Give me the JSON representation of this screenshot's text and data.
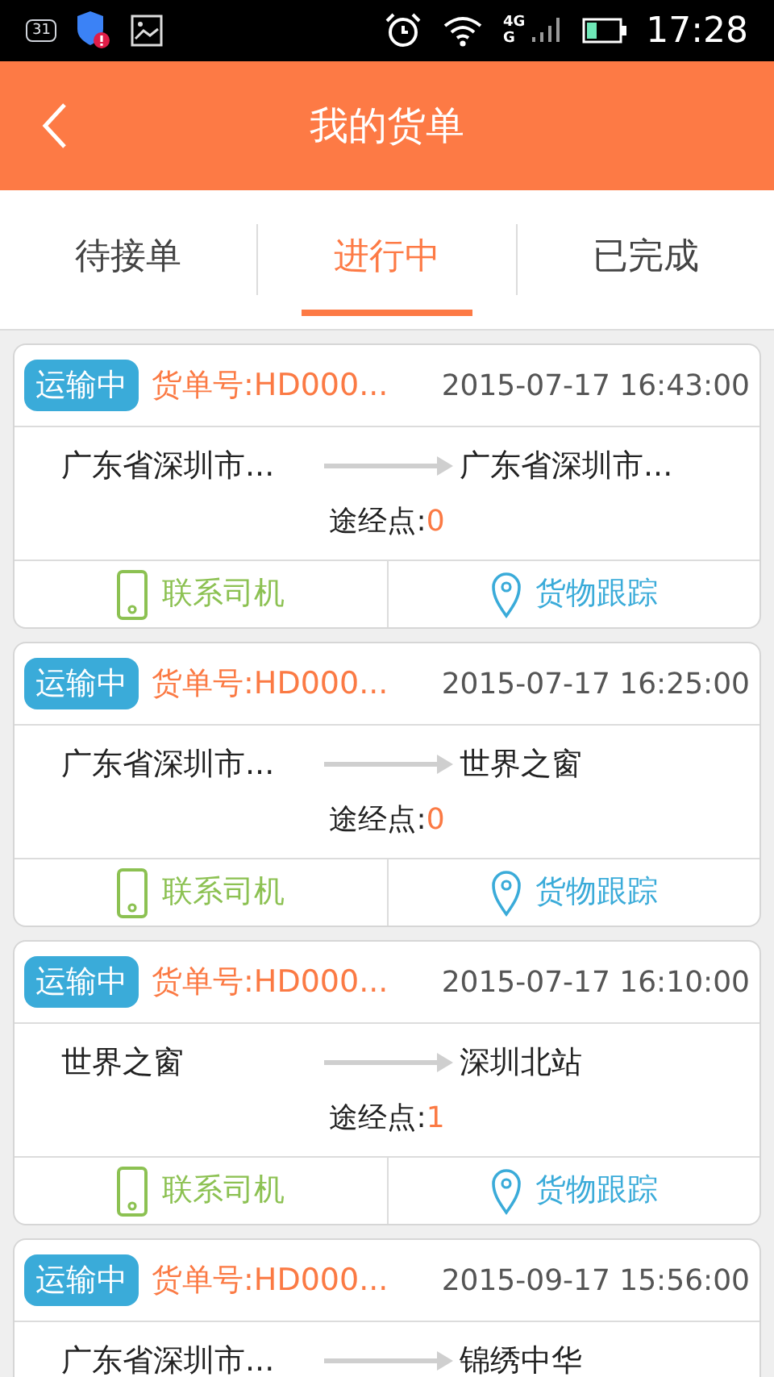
{
  "status_bar": {
    "calendar_day": "31",
    "network": "4G",
    "network_2": "G",
    "time": "17:28"
  },
  "header": {
    "title": "我的货单"
  },
  "tabs": [
    {
      "label": "待接单",
      "selected": false
    },
    {
      "label": "进行中",
      "selected": true
    },
    {
      "label": "已完成",
      "selected": false
    }
  ],
  "orders": [
    {
      "status": "运输中",
      "order_no": "货单号:HD000...",
      "time": "2015-07-17 16:43:00",
      "from": "广东省深圳市...",
      "to": "广东省深圳市...",
      "waypoint_label": "途经点:",
      "waypoint_count": "0",
      "contact": "联系司机",
      "track": "货物跟踪"
    },
    {
      "status": "运输中",
      "order_no": "货单号:HD000...",
      "time": "2015-07-17 16:25:00",
      "from": "广东省深圳市...",
      "to": "世界之窗",
      "waypoint_label": "途经点:",
      "waypoint_count": "0",
      "contact": "联系司机",
      "track": "货物跟踪"
    },
    {
      "status": "运输中",
      "order_no": "货单号:HD000...",
      "time": "2015-07-17 16:10:00",
      "from": "世界之窗",
      "to": "深圳北站",
      "waypoint_label": "途经点:",
      "waypoint_count": "1",
      "contact": "联系司机",
      "track": "货物跟踪"
    },
    {
      "status": "运输中",
      "order_no": "货单号:HD000...",
      "time": "2015-09-17 15:56:00",
      "from": "广东省深圳市...",
      "to": "锦绣中华"
    }
  ]
}
